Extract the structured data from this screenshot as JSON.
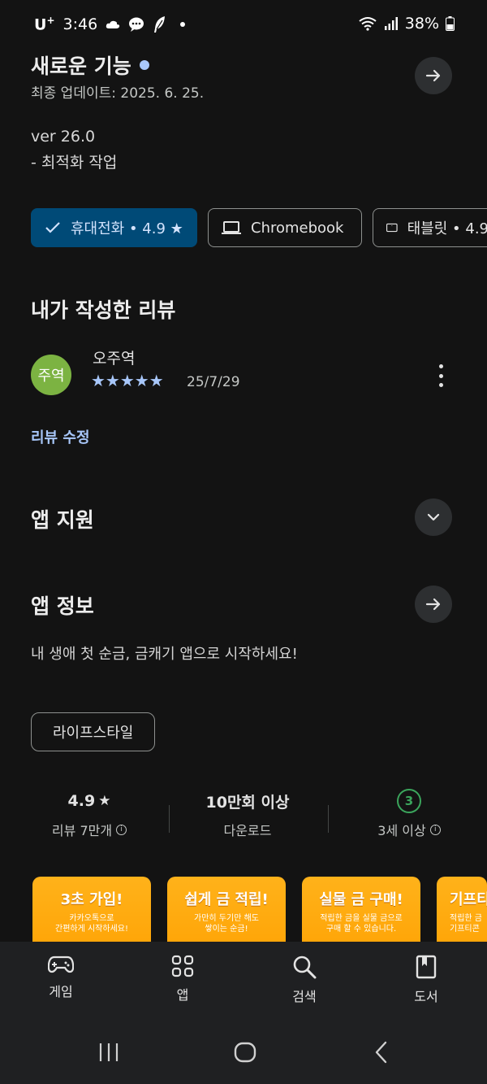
{
  "status_bar": {
    "carrier": "U",
    "carrier_sup": "+",
    "time": "3:46",
    "battery": "38%"
  },
  "whats_new": {
    "title": "새로운 기능",
    "updated": "최종 업데이트: 2025. 6. 25.",
    "version_line": "ver 26.0",
    "notes_line": "- 최적화 작업"
  },
  "device_chips": [
    {
      "label": "휴대전화 • 4.9 ★",
      "icon": "check-icon",
      "selected": true
    },
    {
      "label": "Chromebook",
      "icon": "laptop-icon",
      "selected": false
    },
    {
      "label": "태블릿 • 4.9",
      "icon": "tablet-icon",
      "selected": false
    }
  ],
  "my_review": {
    "title": "내가 작성한 리뷰",
    "avatar_text": "주역",
    "reviewer": "오주역",
    "stars": 5,
    "stars_text": "★★★★★",
    "date": "25/7/29",
    "edit_label": "리뷰 수정"
  },
  "app_support": {
    "title": "앱 지원"
  },
  "app_info": {
    "title": "앱 정보",
    "description": "내 생애 첫 순금, 금캐기 앱으로 시작하세요!",
    "category": "라이프스타일"
  },
  "stats": {
    "rating": "4.9",
    "rating_star": "★",
    "reviews_label": "리뷰 7만개",
    "downloads": "10만회 이상",
    "downloads_label": "다운로드",
    "age_badge": "3",
    "age_label": "3세 이상"
  },
  "screenshots": [
    {
      "title": "3초 가입!",
      "line1": "카카오톡으로",
      "line2": "간편하게 시작하세요!"
    },
    {
      "title": "쉽게 금 적립!",
      "line1": "가만히 두기만 해도",
      "line2": "쌓이는 순금!"
    },
    {
      "title": "실물 금 구매!",
      "line1": "적립한 금을 실물 금으로",
      "line2": "구매 할 수 있습니다."
    },
    {
      "title": "기프티",
      "line1": "적립한 금",
      "line2": "기프티콘"
    }
  ],
  "bottom_nav": {
    "games": "게임",
    "apps": "앱",
    "search": "검색",
    "books": "도서"
  },
  "colors": {
    "background": "#131313",
    "accent": "#a8c7fa",
    "selected_chip": "#004a77",
    "avatar": "#7cb342",
    "age_badge": "#3ba55c"
  }
}
